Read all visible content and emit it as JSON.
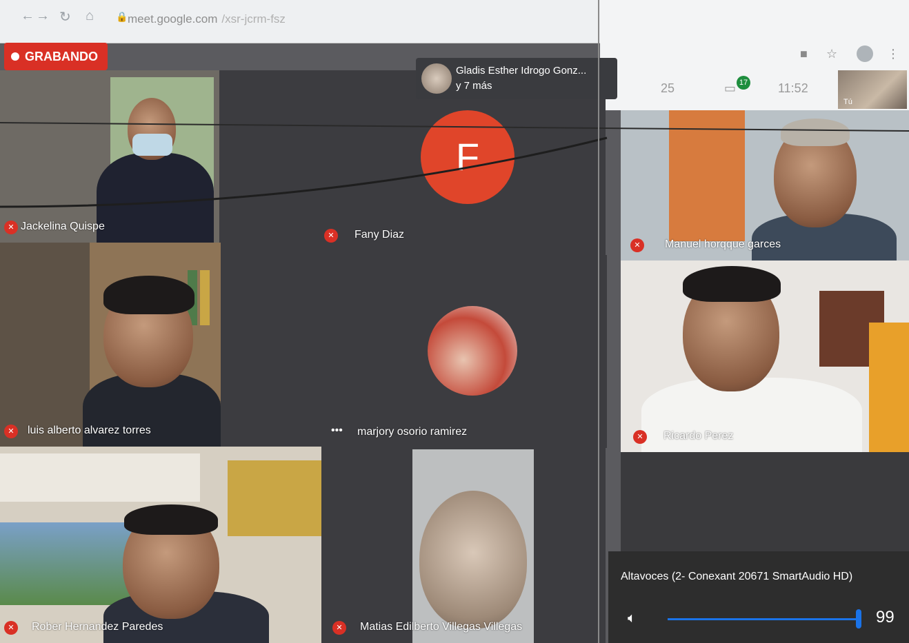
{
  "browser": {
    "url_host": "meet.google.com",
    "url_path": "/xsr-jcrm-fsz"
  },
  "recording": {
    "label": "GRABANDO"
  },
  "header_right": {
    "participants_count": "25",
    "chat_badge": "17",
    "clock": "11:52",
    "selfview_label": "Tú"
  },
  "guest_pill": {
    "name": "Gladis Esther Idrogo Gonz...",
    "more": "y 7 más"
  },
  "tiles": [
    {
      "name": "Jackelina Quispe"
    },
    {
      "name": "Fany Diaz",
      "initial": "F"
    },
    {
      "name": "Manuel horqque garces"
    },
    {
      "name": "luis alberto alvarez torres"
    },
    {
      "name": "marjory osorio ramirez"
    },
    {
      "name": "Ricardo Perez"
    },
    {
      "name": "Rober Hernandez Paredes"
    },
    {
      "name": "Matias Edilberto Villegas Villegas"
    }
  ],
  "volume": {
    "device": "Altavoces (2- Conexant 20671 SmartAudio HD)",
    "level": "99",
    "level_fraction": 0.99
  },
  "icons": {
    "back": "arrow-left-icon",
    "forward": "arrow-right-icon",
    "reload": "reload-icon",
    "home": "home-icon",
    "lock": "lock-icon",
    "mic_off": "mic-off-icon",
    "speaker": "speaker-icon"
  },
  "colors": {
    "record_red": "#d93025",
    "avatar_orange": "#e0452a",
    "accent_blue": "#1a73e8"
  }
}
